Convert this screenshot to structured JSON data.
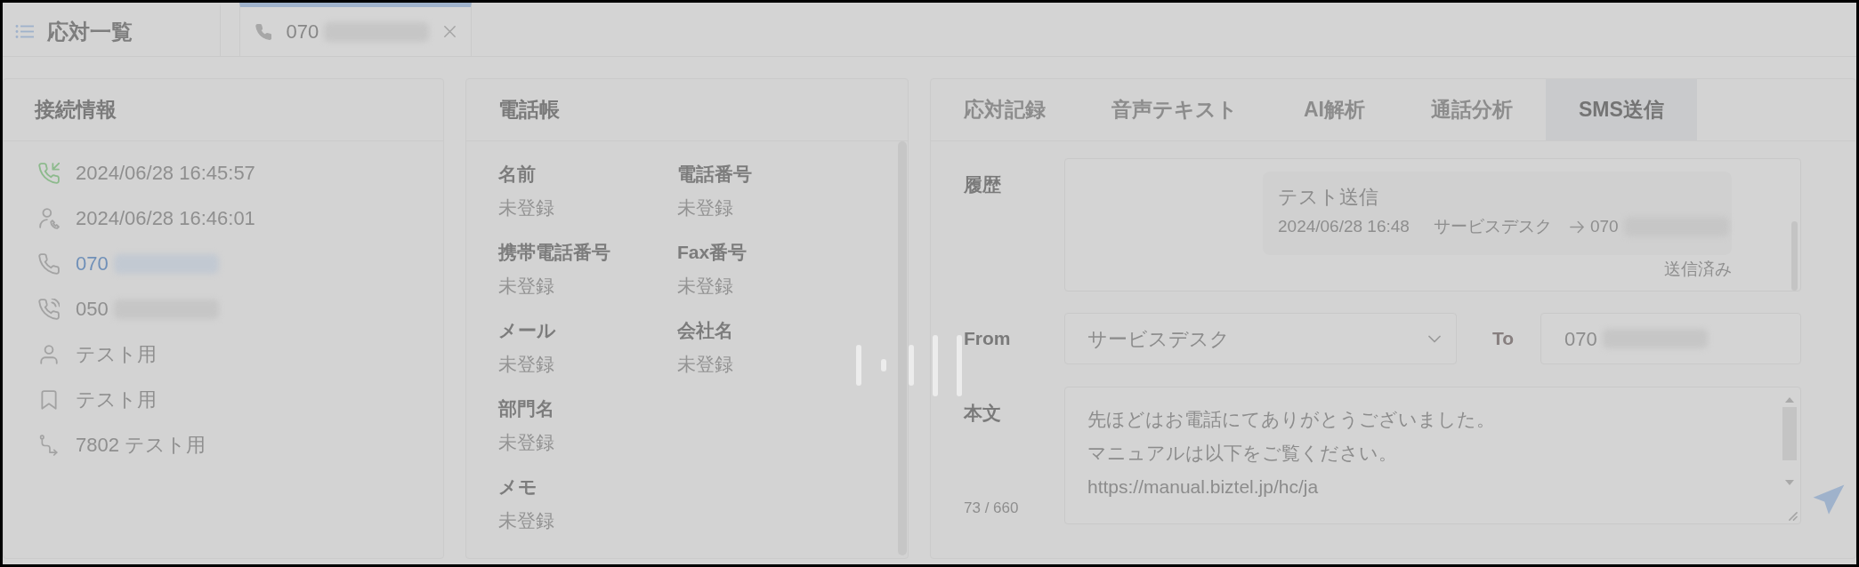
{
  "top_tabs": [
    {
      "kind": "list",
      "label": "応対一覧",
      "selected": false,
      "closable": false,
      "redacted": false
    },
    {
      "kind": "call",
      "label": "070",
      "selected": true,
      "closable": true,
      "redacted": true
    }
  ],
  "connection_info": {
    "title": "接続情報",
    "items": [
      {
        "kind": "incoming",
        "text": "2024/06/28 16:45:57",
        "link": false,
        "redacted": false
      },
      {
        "kind": "answered",
        "text": "2024/06/28 16:46:01",
        "link": false,
        "redacted": false
      },
      {
        "kind": "caller",
        "text": "070",
        "link": true,
        "redacted": true
      },
      {
        "kind": "callee",
        "text": "050",
        "link": false,
        "redacted": true
      },
      {
        "kind": "user",
        "text": "テスト用",
        "link": false,
        "redacted": false
      },
      {
        "kind": "tag",
        "text": "テスト用",
        "link": false,
        "redacted": false
      },
      {
        "kind": "route",
        "text": "7802 テスト用",
        "link": false,
        "redacted": false
      }
    ]
  },
  "phonebook": {
    "title": "電話帳",
    "rows": [
      [
        {
          "label": "名前",
          "value": "未登録"
        },
        {
          "label": "電話番号",
          "value": "未登録"
        }
      ],
      [
        {
          "label": "携帯電話番号",
          "value": "未登録"
        },
        {
          "label": "Fax番号",
          "value": "未登録"
        }
      ],
      [
        {
          "label": "メール",
          "value": "未登録"
        },
        {
          "label": "会社名",
          "value": "未登録"
        }
      ],
      [
        {
          "label": "部門名",
          "value": "未登録"
        }
      ],
      [
        {
          "label": "メモ",
          "value": "未登録"
        }
      ]
    ]
  },
  "detail": {
    "tabs": [
      {
        "label": "応対記録",
        "selected": false
      },
      {
        "label": "音声テキスト",
        "selected": false
      },
      {
        "label": "AI解析",
        "selected": false
      },
      {
        "label": "通話分析",
        "selected": false
      },
      {
        "label": "SMS送信",
        "selected": true
      }
    ],
    "history_label": "履歴",
    "history": [
      {
        "text": "テスト送信",
        "time": "2024/06/28 16:48",
        "sender": "サービスデスク",
        "recipient": "070",
        "recipient_redacted": true,
        "status": "送信済み"
      }
    ],
    "from_label": "From",
    "from_value": "サービスデスク",
    "to_label": "To",
    "to_value": "070",
    "to_redacted": true,
    "body_label": "本文",
    "body_lines": [
      "先ほどはお電話にてありがとうございました。",
      "マニュアルは以下をご覧ください。",
      "https://manual.biztel.jp/hc/ja"
    ],
    "char_count": "73 / 660"
  },
  "loading": true
}
